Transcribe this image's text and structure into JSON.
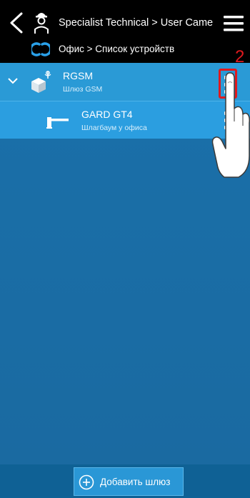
{
  "header": {
    "title": "Specialist Technical > User Came",
    "breadcrumb": "Офис > Список устройств"
  },
  "gateway": {
    "name": "RGSM",
    "type": "Шлюз GSM"
  },
  "device": {
    "name": "GARD GT4",
    "description": "Шлагбаум у офиса"
  },
  "annotation": {
    "step_number": "2",
    "highlight_color": "#e0191e"
  },
  "footer": {
    "add_gateway_label": "Добавить шлюз"
  },
  "icons": {
    "back": "back-arrow-icon",
    "user": "specialist-user-icon",
    "menu": "hamburger-menu-icon",
    "logo": "came-connect-logo-icon",
    "expand": "chevron-down-icon",
    "gateway": "gateway-box-icon",
    "barrier": "barrier-gate-icon",
    "more": "kebab-menu-icon",
    "add": "plus-circle-icon"
  },
  "colors": {
    "header_bg": "#000000",
    "gateway_row_bg": "#2a9ad6",
    "device_row_bg": "#2b9ee0",
    "content_bg": "#1a6aa1",
    "footer_bg": "#0f6195",
    "accent_logo": "#2aa0e8"
  }
}
